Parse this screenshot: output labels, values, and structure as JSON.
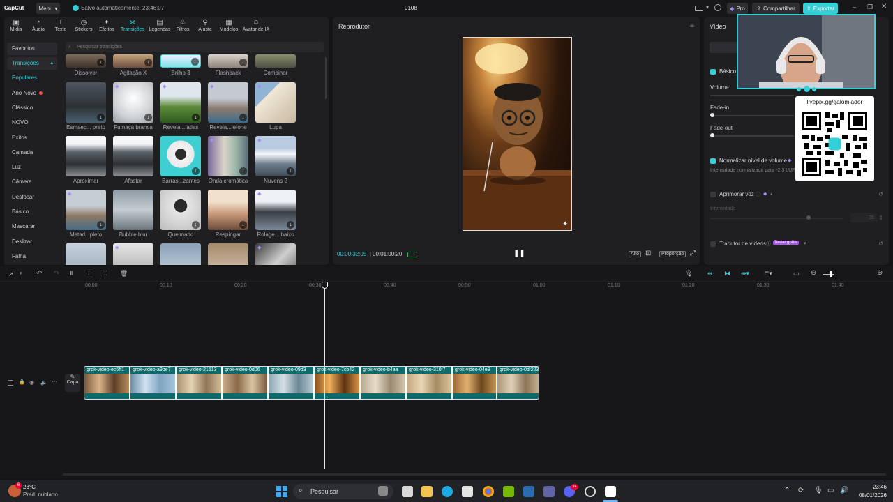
{
  "app": {
    "logo": "CapCut",
    "menu_label": "Menu",
    "autosave": "Salvo automaticamente: 23:46:07",
    "project": "0108",
    "pro_label": "Pro",
    "share_label": "Compartilhar",
    "export_label": "Exportar"
  },
  "toolbar": {
    "items": [
      {
        "label": "Mídia",
        "icon": "media-icon"
      },
      {
        "label": "Áudio",
        "icon": "audio-icon"
      },
      {
        "label": "Texto",
        "icon": "text-icon"
      },
      {
        "label": "Stickers",
        "icon": "sticker-icon"
      },
      {
        "label": "Efeitos",
        "icon": "effects-icon"
      },
      {
        "label": "Transições",
        "icon": "transitions-icon"
      },
      {
        "label": "Legendas",
        "icon": "captions-icon"
      },
      {
        "label": "Filtros",
        "icon": "filters-icon"
      },
      {
        "label": "Ajuste",
        "icon": "adjust-icon"
      },
      {
        "label": "Modelos",
        "icon": "templates-icon"
      },
      {
        "label": "Avatar de IA",
        "icon": "avatar-icon"
      }
    ]
  },
  "sidebar": {
    "items": [
      "Favoritos",
      "Transições",
      "Populares",
      "Ano Novo",
      "Clássico",
      "NOVO",
      "Exitos",
      "Camada",
      "Luz",
      "Câmera",
      "Desfocar",
      "Básico",
      "Mascarar",
      "Deslizar",
      "Falha"
    ]
  },
  "search": {
    "placeholder": "Pesquisar transições"
  },
  "grid": {
    "labels": [
      "Dissolver",
      "Agitação X",
      "Brilho 3",
      "Flashback",
      "Combinar",
      "Esmaec... preto",
      "Fumaça branca",
      "Revela...fatias",
      "Revela...lefone",
      "Lupa",
      "Aproximar",
      "Afastar",
      "Barras...zantes",
      "Onda cromática",
      "Nuvens 2",
      "Metad...pleto",
      "Bubble blur",
      "Queimado",
      "Respingar",
      "Rolage... baixo"
    ]
  },
  "player": {
    "title": "Reprodutor",
    "current_time": "00:00:32:05",
    "total_time": "00:01:00:20",
    "quality": "Alto",
    "ratio": "Proporção"
  },
  "props": {
    "tab": "Vídeo",
    "basic": "Básico",
    "volume": "Volume",
    "volume_value": "0.0dB",
    "fade_in": "Fade-in",
    "fade_out": "Fade-out",
    "normalize": "Normalizar nível de volume",
    "normalize_desc": "Intensidade normalizada para -2.3 LUFS",
    "enhance": "Aprimorar voz",
    "intensity": "Intensidade",
    "intensity_value": "25",
    "translator": "Tradutor de vídeos",
    "trial": "Testar grátis"
  },
  "overlay": {
    "qr_url": "livepix.gg/galomiador"
  },
  "timeline": {
    "ruler": [
      "00:00",
      "00:10",
      "00:20",
      "00:30",
      "00:40",
      "00:50",
      "01:00",
      "01:10",
      "01:20",
      "01:30",
      "01:40"
    ],
    "cover_label": "Capa",
    "clips": [
      "grok-video-ec6ff1",
      "grok-video-a9be7",
      "grok-video-21513",
      "grok-video-0d06",
      "grok-video-09d3",
      "grok-video-7cb42",
      "grok-video-b4aa",
      "grok-video-310f7",
      "grok-video-04e9",
      "grok-video-0df223"
    ]
  },
  "taskbar": {
    "temp": "23°C",
    "weather": "Pred. nublado",
    "search": "Pesquisar",
    "time": "23:46",
    "date": "08/01/2026",
    "notif_badge": "6",
    "discord_badge": "9+"
  },
  "colors": {
    "accent": "#35d0d6",
    "pro": "#a78bfa",
    "export_bg": "#35d0d6"
  }
}
